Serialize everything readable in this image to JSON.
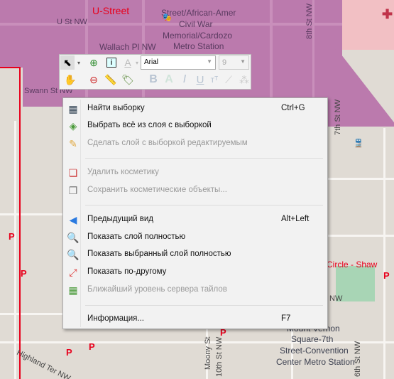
{
  "map": {
    "labels": {
      "u_street_area": "U-Street",
      "u_st": "U St NW",
      "station1": "Street/African-Amer",
      "station2": "Civil War",
      "station3": "Memorial/Cardozo",
      "station4": "Metro Station",
      "wallach": "Wallach Pl NW",
      "swann": "Swann St NW",
      "eighth": "8th St NW",
      "seventh": "7th St NW",
      "circle": "Circle - Shaw",
      "nw": "NW",
      "mv1": "Mount Vernon",
      "mv2": "Square-7th",
      "mv3": "Street-Convention",
      "mv4": "Center Metro Station",
      "moony": "Moony St",
      "tenth": "10th St NW",
      "highland": "Highland Ter NW",
      "sixth": "6th St NW",
      "parking": "P"
    },
    "colors": {
      "district": "#bb7aad",
      "boundary": "#e8001c",
      "park": "#a8d5b5"
    }
  },
  "toolbar": {
    "font": "Arial",
    "size": "9",
    "icons": [
      "select-arrow",
      "zoom-in",
      "info",
      "text-color",
      "pan-hand",
      "zoom-out",
      "ruler",
      "label-tag",
      "bold",
      "outline",
      "italic",
      "underline",
      "superscript",
      "node-edit",
      "reshape"
    ]
  },
  "menu": {
    "items": [
      {
        "label": "Найти выборку",
        "shortcut": "Ctrl+G",
        "enabled": true,
        "icon": "find-selection"
      },
      {
        "label": "Выбрать всё из слоя с выборкой",
        "shortcut": "",
        "enabled": true,
        "icon": "layers"
      },
      {
        "label": "Сделать слой с выборкой редактируемым",
        "shortcut": "",
        "enabled": false,
        "icon": "pencil"
      },
      {
        "label": "Удалить косметику",
        "shortcut": "",
        "enabled": false,
        "icon": "delete-cosmetic"
      },
      {
        "label": "Сохранить косметические объекты...",
        "shortcut": "",
        "enabled": false,
        "icon": "save-cosmetic"
      },
      {
        "label": "Предыдущий вид",
        "shortcut": "Alt+Left",
        "enabled": true,
        "icon": "back-arrow"
      },
      {
        "label": "Показать слой полностью",
        "shortcut": "",
        "enabled": true,
        "icon": "view-layer"
      },
      {
        "label": "Показать выбранный слой полностью",
        "shortcut": "",
        "enabled": true,
        "icon": "view-selected"
      },
      {
        "label": "Показать по-другому",
        "shortcut": "",
        "enabled": true,
        "icon": "change-view"
      },
      {
        "label": "Ближайший уровень сервера тайлов",
        "shortcut": "",
        "enabled": false,
        "icon": "tile-server"
      },
      {
        "label": "Информация...",
        "shortcut": "F7",
        "enabled": true,
        "icon": ""
      }
    ]
  }
}
